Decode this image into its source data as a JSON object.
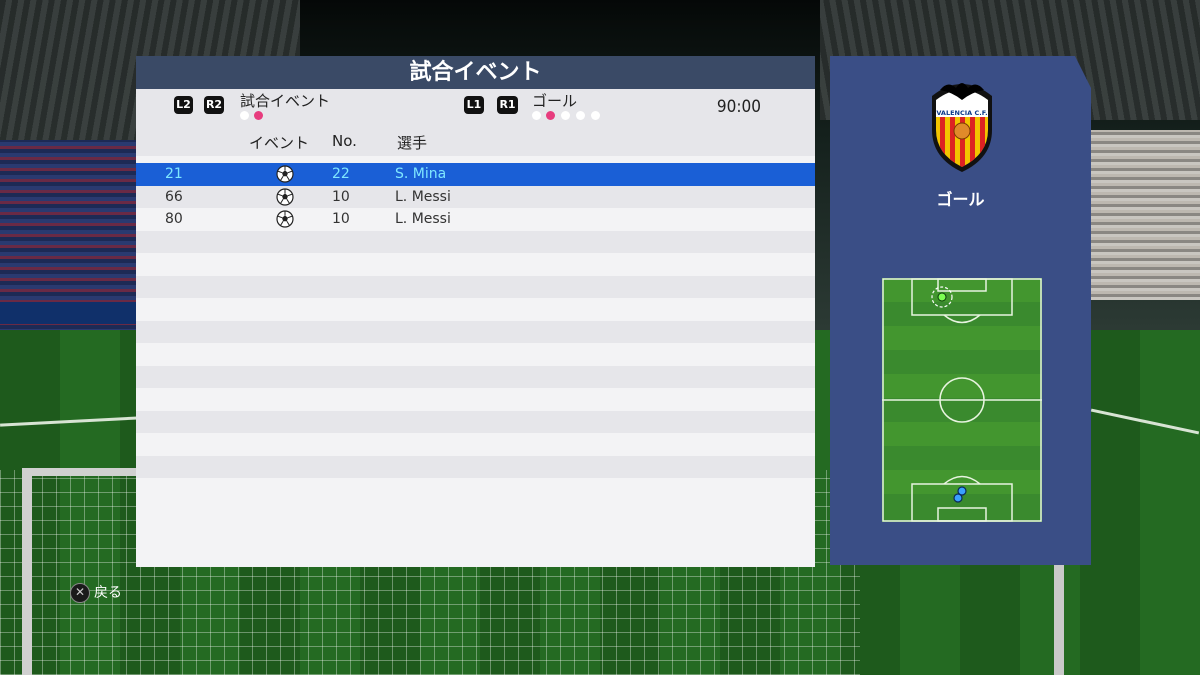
{
  "panel": {
    "title": "試合イベント"
  },
  "filters": [
    {
      "keys": [
        "L2",
        "R2"
      ],
      "label": "試合イベント",
      "dots": [
        false,
        true
      ]
    },
    {
      "keys": [
        "L1",
        "R1"
      ],
      "label": "ゴール",
      "dots": [
        false,
        true,
        false,
        false,
        false
      ]
    }
  ],
  "clock": "90:00",
  "columns": {
    "event": "イベント",
    "no": "No.",
    "player": "選手"
  },
  "events": [
    {
      "time": "21",
      "icon": "soccer-ball-icon",
      "no": "22",
      "player": "S. Mina",
      "selected": true
    },
    {
      "time": "66",
      "icon": "soccer-ball-icon",
      "no": "10",
      "player": "L. Messi",
      "selected": false
    },
    {
      "time": "80",
      "icon": "soccer-ball-icon",
      "no": "10",
      "player": "L. Messi",
      "selected": false
    }
  ],
  "side": {
    "crest_text": "VALENCIA C.F.",
    "label": "ゴール"
  },
  "back": {
    "key_icon": "cross-button-icon",
    "label": "戻る"
  },
  "colors": {
    "selected_row": "#1a5fd6",
    "selected_text": "#7fe7ff",
    "title_bar": "#3a4a66",
    "side_panel": "#3a4e86",
    "active_dot": "#e73c7e"
  }
}
